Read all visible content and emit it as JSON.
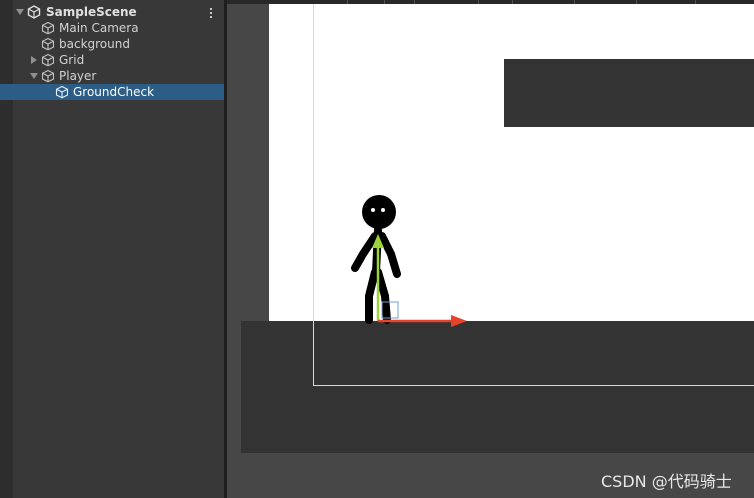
{
  "hierarchy": {
    "scene": {
      "label": "SampleScene",
      "icon": "unity-scene-icon"
    },
    "menu_icon": "kebab-menu-icon",
    "items": [
      {
        "label": "Main Camera",
        "icon": "gameobject-cube-icon",
        "expanded": null
      },
      {
        "label": "background",
        "icon": "gameobject-cube-icon",
        "expanded": null
      },
      {
        "label": "Grid",
        "icon": "gameobject-cube-icon",
        "expanded": false
      },
      {
        "label": "Player",
        "icon": "gameobject-cube-icon",
        "expanded": true
      },
      {
        "label": "GroundCheck",
        "icon": "gameobject-cube-icon",
        "expanded": null,
        "selected": true
      }
    ]
  },
  "scene_view": {
    "gizmo_colors": {
      "x_axis": "#e8432a",
      "y_axis": "#9cd43a"
    },
    "selection_color": "#2c5d87"
  },
  "watermark": "CSDN @代码骑士"
}
